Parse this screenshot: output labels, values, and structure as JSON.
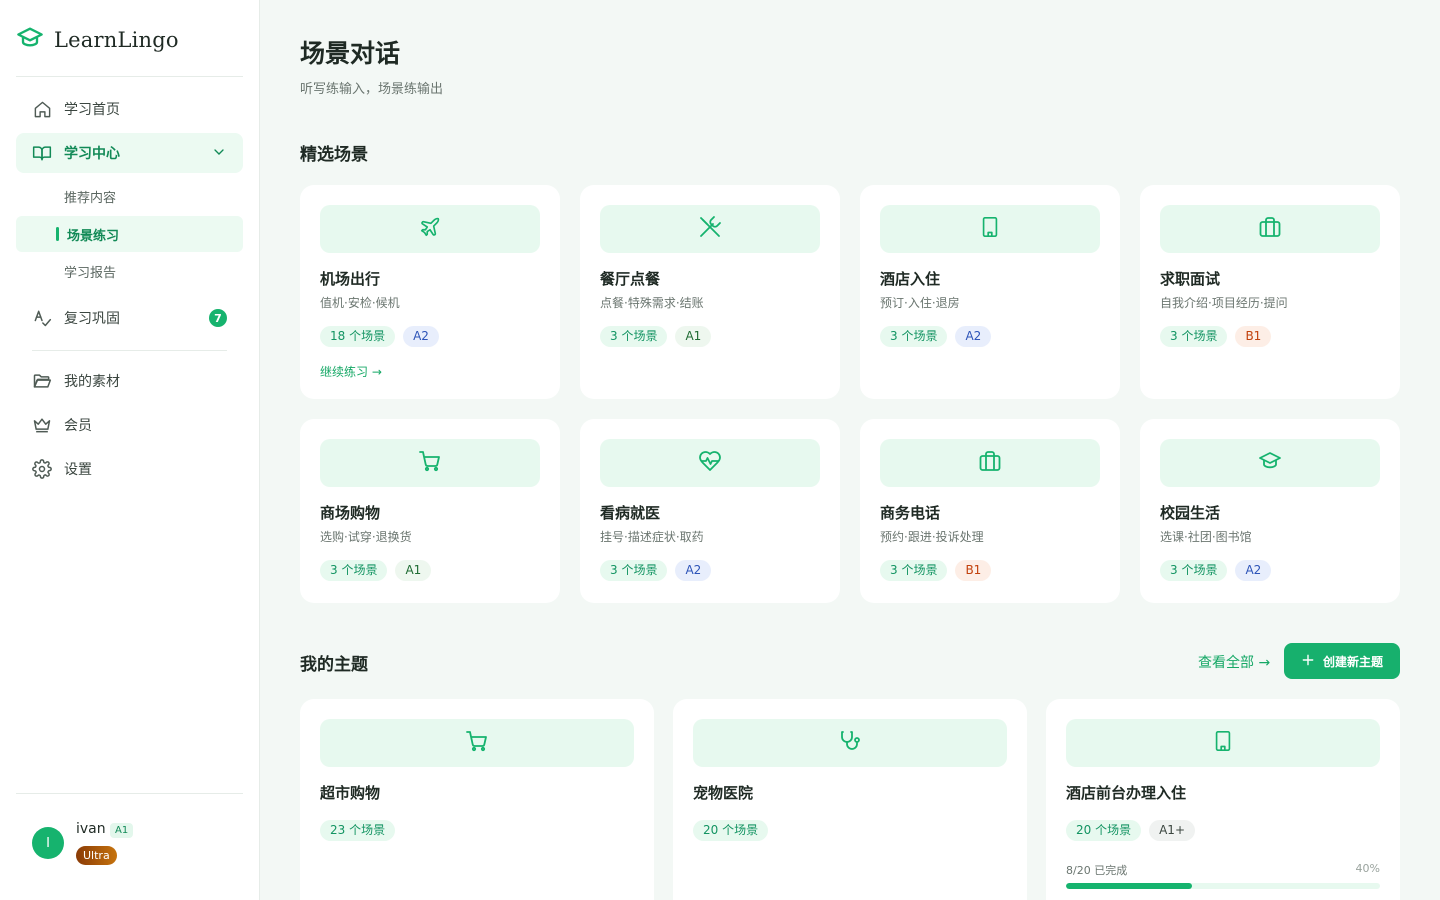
{
  "app": {
    "name": "LearnLingo"
  },
  "sidebar": {
    "nav": [
      {
        "label": "学习首页",
        "icon": "home-icon"
      },
      {
        "label": "学习中心",
        "icon": "book-open-icon",
        "expanded": true,
        "children": [
          {
            "label": "推荐内容"
          },
          {
            "label": "场景练习",
            "current": true
          },
          {
            "label": "学习报告"
          }
        ]
      },
      {
        "label": "复习巩固",
        "icon": "spell-check-icon",
        "badge": "7"
      },
      {
        "label": "我的素材",
        "icon": "folder-icon"
      },
      {
        "label": "会员",
        "icon": "crown-icon"
      },
      {
        "label": "设置",
        "icon": "gear-icon"
      }
    ],
    "user": {
      "initial": "I",
      "name": "ivan",
      "level": "A1",
      "plan": "Ultra"
    }
  },
  "page": {
    "title": "场景对话",
    "subtitle": "听写练输入，场景练输出"
  },
  "featured": {
    "title": "精选场景",
    "cards": [
      {
        "title": "机场出行",
        "desc": "值机·安检·候机",
        "count": "18 个场景",
        "level": "A2",
        "icon": "plane-icon",
        "cta": "继续练习 →"
      },
      {
        "title": "餐厅点餐",
        "desc": "点餐·特殊需求·结账",
        "count": "3 个场景",
        "level": "A1",
        "icon": "utensils-icon"
      },
      {
        "title": "酒店入住",
        "desc": "预订·入住·退房",
        "count": "3 个场景",
        "level": "A2",
        "icon": "hotel-icon"
      },
      {
        "title": "求职面试",
        "desc": "自我介绍·项目经历·提问",
        "count": "3 个场景",
        "level": "B1",
        "icon": "briefcase-icon"
      },
      {
        "title": "商场购物",
        "desc": "选购·试穿·退换货",
        "count": "3 个场景",
        "level": "A1",
        "icon": "cart-icon"
      },
      {
        "title": "看病就医",
        "desc": "挂号·描述症状·取药",
        "count": "3 个场景",
        "level": "A2",
        "icon": "heart-pulse-icon"
      },
      {
        "title": "商务电话",
        "desc": "预约·跟进·投诉处理",
        "count": "3 个场景",
        "level": "B1",
        "icon": "briefcase-icon"
      },
      {
        "title": "校园生活",
        "desc": "选课·社团·图书馆",
        "count": "3 个场景",
        "level": "A2",
        "icon": "graduation-cap-icon"
      }
    ]
  },
  "topics": {
    "title": "我的主题",
    "view_all": "查看全部 →",
    "create_label": "创建新主题",
    "cards": [
      {
        "title": "超市购物",
        "count": "23 个场景",
        "icon": "cart-icon"
      },
      {
        "title": "宠物医院",
        "count": "20 个场景",
        "icon": "stethoscope-icon"
      },
      {
        "title": "酒店前台办理入住",
        "count": "20 个场景",
        "level": "A1+",
        "icon": "hotel-icon",
        "progress_text": "8/20 已完成",
        "progress_pct": "40%",
        "progress": 0.4
      }
    ]
  },
  "colors": {
    "accent": "#16b36e",
    "accent_dark": "#128a57",
    "bg": "#f3f8f5"
  }
}
